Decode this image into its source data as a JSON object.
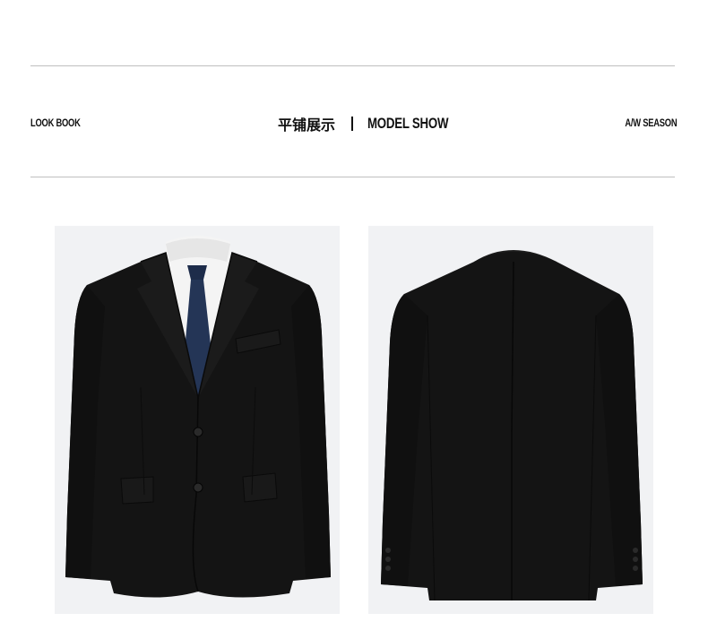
{
  "header": {
    "left_label": "LOOK BOOK",
    "center_cn": "平铺展示",
    "center_en": "MODEL SHOW",
    "right_label": "A/W SEASON"
  },
  "images": [
    {
      "view": "front",
      "name": "suit-front-photo"
    },
    {
      "view": "back",
      "name": "suit-back-photo"
    }
  ],
  "colors": {
    "background": "#ffffff",
    "rule": "#bfbfbf",
    "text": "#111111",
    "photo_bg": "#f1f2f4",
    "suit": "#141414",
    "shirt": "#f4f4f4",
    "tie": "#243556"
  }
}
